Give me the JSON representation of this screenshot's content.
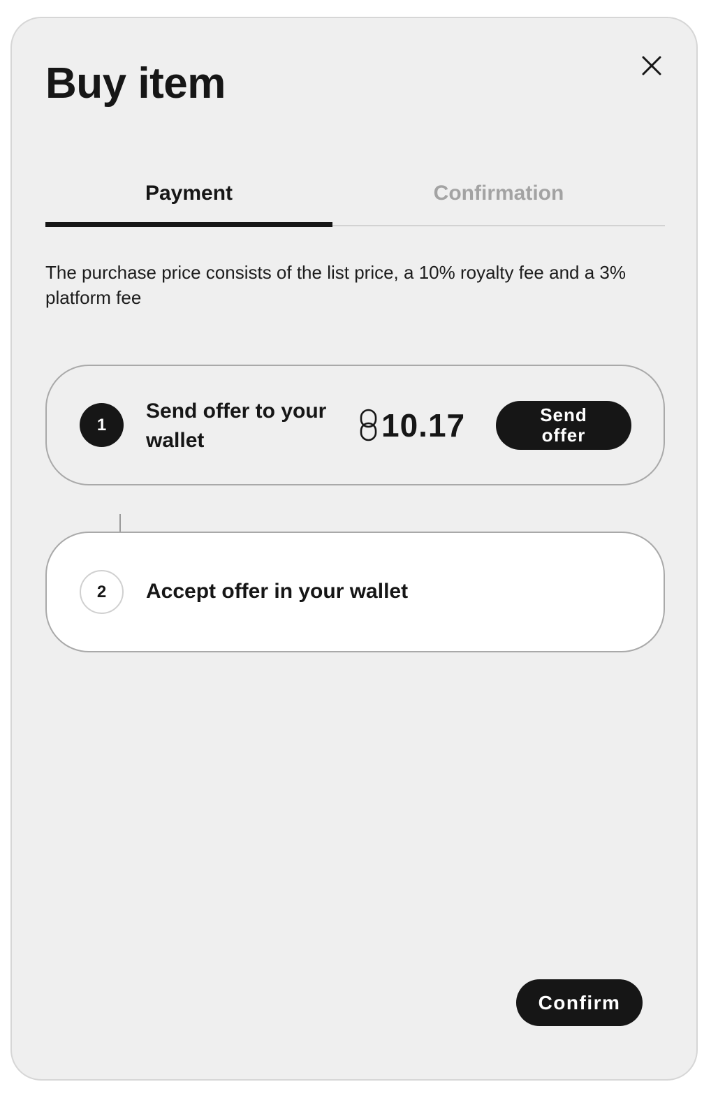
{
  "modal": {
    "title": "Buy item",
    "close_icon": "close-icon"
  },
  "tabs": [
    {
      "label": "Payment",
      "active": true
    },
    {
      "label": "Confirmation",
      "active": false
    }
  ],
  "description": "The purchase price consists of the list price, a 10% royalty fee and a 3% platform fee",
  "steps": [
    {
      "number": "1",
      "label": "Send offer to your wallet",
      "status": "active",
      "price": "10.17",
      "currency_icon": "chainlink-currency-icon",
      "button_label": "Send offer"
    },
    {
      "number": "2",
      "label": "Accept offer in your wallet",
      "status": "pending"
    }
  ],
  "footer": {
    "confirm_label": "Confirm"
  },
  "colors": {
    "background": "#efefef",
    "primary": "#161616",
    "inactive_tab": "#a3a3a3",
    "step_border": "#a9a9a9"
  }
}
